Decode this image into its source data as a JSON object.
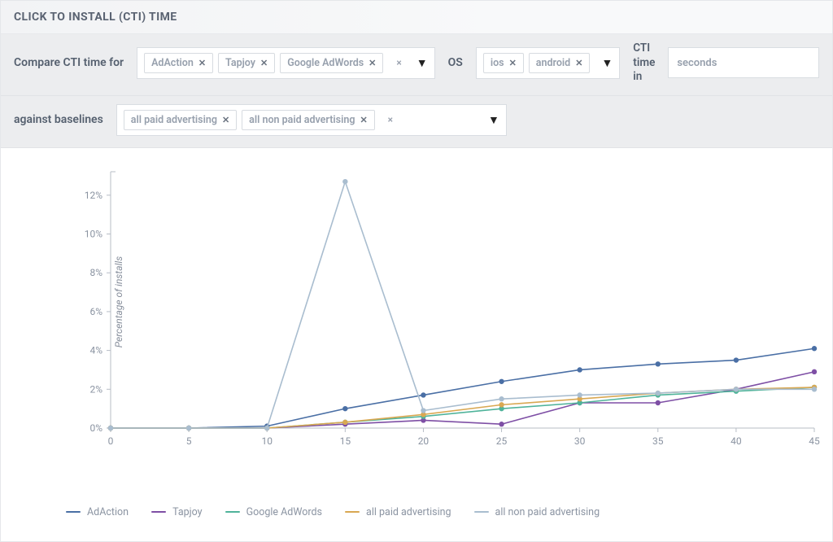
{
  "header": {
    "title": "CLICK TO INSTALL (CTI) TIME"
  },
  "filters": {
    "compare_label": "Compare CTI time for",
    "compare_tags": [
      "AdAction",
      "Tapjoy",
      "Google AdWords"
    ],
    "os_label": "OS",
    "os_tags": [
      "ios",
      "android"
    ],
    "cti_unit_label_l1": "CTI",
    "cti_unit_label_l2": "time",
    "cti_unit_label_l3": "in",
    "cti_unit_value": "seconds",
    "baselines_label": "against baselines",
    "baselines_tags": [
      "all paid advertising",
      "all non paid advertising"
    ]
  },
  "legend": [
    {
      "name": "AdAction",
      "color": "#4a6fa5"
    },
    {
      "name": "Tapjoy",
      "color": "#7e4fa5"
    },
    {
      "name": "Google AdWords",
      "color": "#4fb39a"
    },
    {
      "name": "all paid advertising",
      "color": "#d9a852"
    },
    {
      "name": "all non paid advertising",
      "color": "#a9bdcf"
    }
  ],
  "chart_data": {
    "type": "line",
    "xlabel": "",
    "ylabel": "Percentage of installs",
    "x": [
      0,
      5,
      10,
      15,
      20,
      25,
      30,
      35,
      40,
      45
    ],
    "y_ticks": [
      0,
      2,
      4,
      6,
      8,
      10,
      12
    ],
    "y_tick_labels": [
      "0%",
      "2%",
      "4%",
      "6%",
      "8%",
      "10%",
      "12%"
    ],
    "ylim": [
      0,
      13
    ],
    "series": [
      {
        "name": "AdAction",
        "color": "#4a6fa5",
        "values": [
          0.0,
          0.0,
          0.1,
          1.0,
          1.7,
          2.4,
          3.0,
          3.3,
          3.5,
          4.1
        ]
      },
      {
        "name": "Tapjoy",
        "color": "#7e4fa5",
        "values": [
          0.0,
          0.0,
          0.0,
          0.2,
          0.4,
          0.2,
          1.3,
          1.3,
          2.0,
          2.9
        ]
      },
      {
        "name": "Google AdWords",
        "color": "#4fb39a",
        "values": [
          0.0,
          0.0,
          0.0,
          0.3,
          0.6,
          1.0,
          1.3,
          1.7,
          1.9,
          2.1
        ]
      },
      {
        "name": "all paid advertising",
        "color": "#d9a852",
        "values": [
          0.0,
          0.0,
          0.0,
          0.3,
          0.7,
          1.2,
          1.5,
          1.8,
          2.0,
          2.1
        ]
      },
      {
        "name": "all non paid advertising",
        "color": "#a9bdcf",
        "values": [
          0.0,
          0.0,
          0.0,
          12.7,
          0.9,
          1.5,
          1.7,
          1.8,
          2.0,
          2.0
        ]
      }
    ]
  }
}
